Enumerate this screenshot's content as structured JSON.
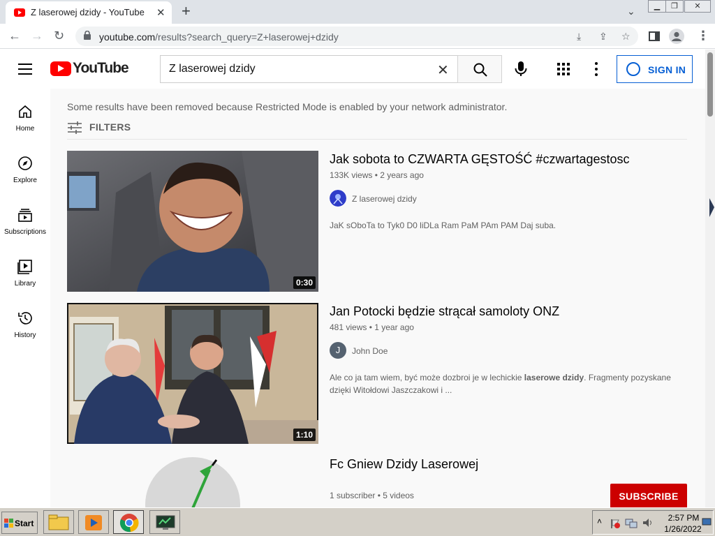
{
  "browser": {
    "tab_title": "Z laserowej dzidy - YouTube",
    "url_host": "youtube.com",
    "url_path": "/results?search_query=Z+laserowej+dzidy"
  },
  "header": {
    "logo_text": "YouTube",
    "search_value": "Z laserowej dzidy",
    "signin_label": "SIGN IN"
  },
  "sidebar": {
    "items": [
      {
        "label": "Home",
        "icon": "home-icon"
      },
      {
        "label": "Explore",
        "icon": "compass-icon"
      },
      {
        "label": "Subscriptions",
        "icon": "subscriptions-icon"
      },
      {
        "label": "Library",
        "icon": "library-icon"
      },
      {
        "label": "History",
        "icon": "history-icon"
      }
    ]
  },
  "main": {
    "notice": "Some results have been removed because Restricted Mode is enabled by your network administrator.",
    "filters_label": "FILTERS",
    "results": [
      {
        "title": "Jak sobota to CZWARTA GĘSTOŚĆ #czwartagestosc",
        "meta": "133K views • 2 years ago",
        "channel": "Z laserowej dzidy",
        "description": "JaK sObоTa to Tyk0 D0 liDLa Ram PaM PAm PAM Daj suba.",
        "duration": "0:30"
      },
      {
        "title": "Jan Potocki będzie strącał samoloty ONZ",
        "meta": "481 views • 1 year ago",
        "channel": "John Doe",
        "channel_initial": "J",
        "description_before": "Ale co ja tam wiem, być może dozbroi je w lechickie ",
        "description_bold": "laserowe dzidy",
        "description_after": ". Fragmenty pozyskane dzięki Witołdowi Jaszczakowi i ...",
        "duration": "1:10"
      },
      {
        "title": "Fc Gniew Dzidy Laserowej",
        "meta": "1 subscriber • 5 videos",
        "subscribe_label": "SUBSCRIBE"
      }
    ]
  },
  "taskbar": {
    "start_label": "Start",
    "clock_time": "2:57 PM",
    "clock_date": "1/26/2022"
  }
}
